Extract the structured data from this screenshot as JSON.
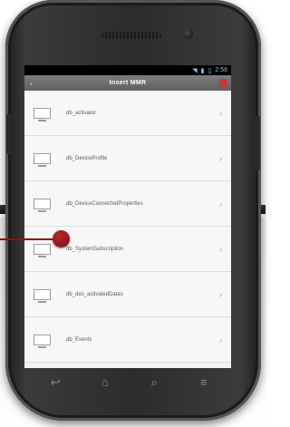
{
  "status_bar": {
    "time": "2:58",
    "icons": [
      "wifi-icon",
      "signal-icon",
      "battery-icon"
    ]
  },
  "action_bar": {
    "title": "Insert MMR"
  },
  "list": {
    "items": [
      {
        "label": "db_activator"
      },
      {
        "label": "db_DeviceProfile"
      },
      {
        "label": "db_DeviceConnectedProperties"
      },
      {
        "label": "db_SystemSubscription"
      },
      {
        "label": "db_des_activatedDatas"
      },
      {
        "label": "db_Events"
      }
    ]
  },
  "nav_bar": {
    "buttons": [
      {
        "name": "back-icon",
        "glyph": "↩"
      },
      {
        "name": "home-icon",
        "glyph": "⌂"
      },
      {
        "name": "search-icon",
        "glyph": "⌕"
      },
      {
        "name": "menu-icon",
        "glyph": "≡"
      }
    ]
  },
  "colors": {
    "action_bar": "#6e6e6e",
    "pointer": "#a01f1f",
    "phone_body": "#2c2c2c"
  }
}
